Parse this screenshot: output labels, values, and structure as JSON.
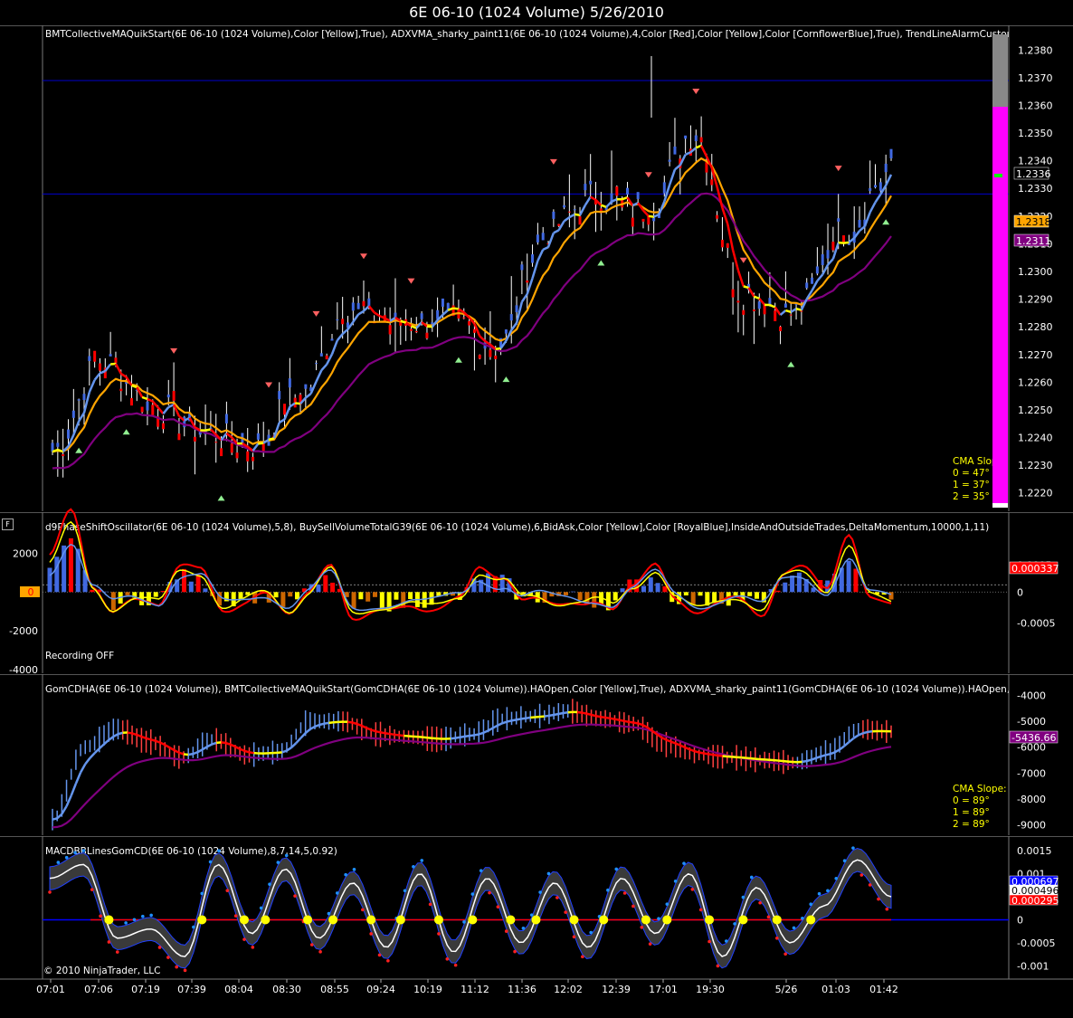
{
  "window_title": "6E 06-10 (1024 Volume)  5/26/2010",
  "panels": {
    "price": {
      "label": "BMTCollectiveMAQuikStart(6E 06-10 (1024 Volume),Color [Yellow],True), ADXVMA_sharky_paint11(6E 06-10 (1024 Volume),4,Color [Red],Color [Yellow],Color [CornflowerBlue],True), TrendLineAlarmCustom(6E 06",
      "y_ticks": [
        "1.2380",
        "1.2370",
        "1.2360",
        "1.2350",
        "1.2340",
        "1.2330",
        "1.2320",
        "1.2310",
        "1.2300",
        "1.2290",
        "1.2280",
        "1.2270",
        "1.2260",
        "1.2250",
        "1.2240",
        "1.2230",
        "1.2220"
      ],
      "price_tags": [
        {
          "value": "1.2336",
          "color": "#ffffff",
          "bg": "#000000"
        },
        {
          "value": "1.2318",
          "color": "#000000",
          "bg": "#ffa500"
        },
        {
          "value": "1.2311",
          "color": "#ffffff",
          "bg": "#800080"
        }
      ],
      "slope_title": "CMA Slope:",
      "slope_lines": [
        "0 = 47°",
        "1 = 37°",
        "2 = 35°"
      ]
    },
    "oscillator": {
      "label": "d9PhaseShiftOscillator(6E 06-10 (1024 Volume),5,8), BuySellVolumeTotalG39(6E 06-10 (1024 Volume),6,BidAsk,Color [Yellow],Color [RoyalBlue],InsideAndOutsideTrades,DeltaMomentum,10000,1,11)",
      "left_ticks": [
        "2000",
        "0",
        "-2000",
        "-4000"
      ],
      "right_ticks": [
        "0.0005",
        "0",
        "-0.0005"
      ],
      "tag_value": "0.000337",
      "zero_tag": "0",
      "recording": "Recording OFF",
      "f_button": "F"
    },
    "gomcd": {
      "label": "GomCDHA(6E 06-10 (1024 Volume)), BMTCollectiveMAQuikStart(GomCDHA(6E 06-10 (1024 Volume)).HAOpen,Color [Yellow],True), ADXVMA_sharky_paint11(GomCDHA(6E 06-10 (1024 Volume)).HAOpen,4,Color",
      "y_ticks": [
        "-4000",
        "-5000",
        "-6000",
        "-7000",
        "-8000",
        "-9000"
      ],
      "tag_value": "-5436.66",
      "slope_title": "CMA Slope:",
      "slope_lines": [
        "0 = 89°",
        "1 = 89°",
        "2 = 89°"
      ]
    },
    "macd": {
      "label": "MACDBBLinesGomCD(6E 06-10 (1024 Volume),8,7,14,5,0.92)",
      "y_ticks": [
        "0.0015",
        "0.001",
        "0",
        "-0.0005",
        "-0.001"
      ],
      "tags": [
        {
          "value": "0.000697",
          "color": "#ffffff",
          "bg": "#0000ff"
        },
        {
          "value": "0.000496",
          "color": "#000000",
          "bg": "#ffffff"
        },
        {
          "value": "0.000295",
          "color": "#ffffff",
          "bg": "#ff0000"
        }
      ],
      "copyright": "© 2010 NinjaTrader, LLC"
    }
  },
  "time_axis": [
    "07:01",
    "07:06",
    "07:19",
    "07:39",
    "08:04",
    "08:30",
    "08:55",
    "09:24",
    "10:19",
    "11:12",
    "11:36",
    "12:02",
    "12:39",
    "17:01",
    "19:30",
    "5/26",
    "01:03",
    "01:42"
  ],
  "colors": {
    "fast_ma": "#6495ed",
    "mid_ma": "#ffa500",
    "slow_ma": "#800080",
    "adx_up": "#6495ed",
    "adx_down": "#ff0000",
    "adx_flat": "#ffff00",
    "bar": "#ffffff",
    "hline": "#0000cd",
    "magenta": "#ff00ff"
  },
  "chart_data": [
    {
      "type": "line",
      "name": "price",
      "title": "6E 06-10 (1024 Volume)  5/26/2010",
      "x": [
        "07:01",
        "07:06",
        "07:19",
        "07:39",
        "08:04",
        "08:30",
        "08:55",
        "09:24",
        "10:19",
        "11:12",
        "11:36",
        "12:02",
        "12:39",
        "17:01",
        "19:30",
        "5/26",
        "01:03",
        "01:42"
      ],
      "ylim": [
        1.2215,
        1.2385
      ],
      "series": [
        {
          "values": [
            1.2235,
            1.2268,
            1.2252,
            1.2242,
            1.2237,
            1.2255,
            1.2287,
            1.2281,
            1.2283,
            1.2273,
            1.2315,
            1.2327,
            1.2322,
            1.235,
            1.2292,
            1.2285,
            1.2315,
            1.2336
          ]
        }
      ],
      "hlines": [
        1.2369,
        1.2328
      ]
    },
    {
      "type": "bar",
      "name": "oscillator",
      "ylim": [
        -4000,
        3000
      ],
      "values": [
        1200,
        2500,
        300,
        -600,
        -400,
        -300,
        900,
        600,
        -500,
        -300,
        -200,
        -600,
        100,
        700,
        -800,
        -500,
        -700,
        -500,
        -400,
        -300,
        800,
        600,
        -400,
        -300,
        -200,
        -500,
        -600,
        400,
        800,
        -300,
        -500,
        -400,
        -300,
        -600,
        500,
        700,
        300,
        1800,
        -300,
        -200
      ]
    },
    {
      "type": "line",
      "name": "gomcd",
      "ylim": [
        -9300,
        -3700
      ],
      "series": [
        {
          "values": [
            -8800,
            -6000,
            -5300,
            -5800,
            -6400,
            -5700,
            -6300,
            -6200,
            -5000,
            -5000,
            -5500,
            -5600,
            -5700,
            -5500,
            -4900,
            -4800,
            -4600,
            -4900,
            -5100,
            -5900,
            -6300,
            -6400,
            -6500,
            -6600,
            -6200,
            -5300,
            -5400
          ]
        }
      ]
    },
    {
      "type": "line",
      "name": "macd",
      "ylim": [
        -0.00115,
        0.0016
      ],
      "series": [
        {
          "values": [
            0.0009,
            0.0012,
            -0.0004,
            -0.0002,
            -0.0008,
            0.0012,
            -0.0003,
            0.0011,
            -0.0004,
            0.0008,
            -0.0006,
            0.001,
            -0.0007,
            0.0009,
            -0.0005,
            0.0008,
            -0.0006,
            0.0009,
            -0.0003,
            0.001,
            -0.0008,
            0.0007,
            -0.0005,
            0.0003,
            0.0013,
            0.0005
          ]
        }
      ]
    }
  ]
}
